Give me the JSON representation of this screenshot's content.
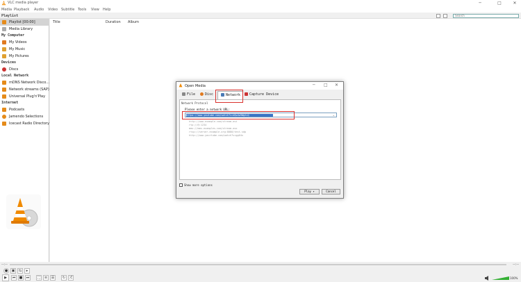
{
  "window": {
    "title": "VLC media player"
  },
  "menu": [
    "Media",
    "Playback",
    "Audio",
    "Video",
    "Subtitle",
    "Tools",
    "View",
    "Help"
  ],
  "playlist": {
    "header": "Playlist",
    "search_placeholder": "Search"
  },
  "sidebar": {
    "top": [
      {
        "label": "Playlist [00:00]"
      },
      {
        "label": "Media Library"
      }
    ],
    "sections": [
      {
        "title": "My Computer",
        "items": [
          "My Videos",
          "My Music",
          "My Pictures"
        ]
      },
      {
        "title": "Devices",
        "items": [
          "Discs"
        ]
      },
      {
        "title": "Local Network",
        "items": [
          "mDNS Network Disco...",
          "Network streams (SAP)",
          "Universal Plug'n'Play"
        ]
      },
      {
        "title": "Internet",
        "items": [
          "Podcasts",
          "Jamendo Selections",
          "Icecast Radio Directory"
        ]
      }
    ]
  },
  "columns": [
    "Title",
    "Duration",
    "Album"
  ],
  "player": {
    "time_left": "--:--",
    "time_right": "--:--",
    "volume": "100%",
    "volume_level": 1.0
  },
  "dialog": {
    "title": "Open Media",
    "tabs": [
      "File",
      "Disc",
      "Network",
      "Capture Device"
    ],
    "group": "Network Protocol",
    "prompt": "Please enter a network URL:",
    "url_value": "https://www.youtube.com/watch?v=dQw4w9WgXcQ",
    "examples": [
      "http://www.example.com/stream.avi",
      "rtp://@:1234",
      "mms://mms.examples.com/stream.asx",
      "rtsp://server.example.org:8080/test.sdp",
      "http://www.yourtube.com/watch?v=gg64x"
    ],
    "show_more": "Show more options",
    "play": "Play",
    "cancel": "Cancel"
  }
}
